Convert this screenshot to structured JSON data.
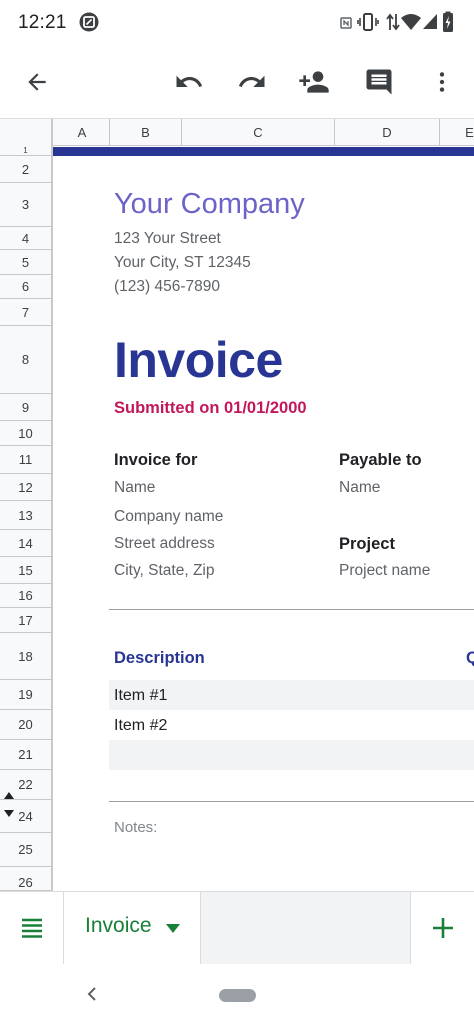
{
  "status_bar": {
    "time": "12:21",
    "icons": [
      "screenshot-icon",
      "nfc-icon",
      "vibrate-icon",
      "data-arrows-icon",
      "wifi-icon",
      "signal-icon",
      "battery-charging-icon"
    ]
  },
  "toolbar": {
    "icons": [
      "back-arrow-icon",
      "undo-icon",
      "redo-icon",
      "add-person-icon",
      "comment-icon",
      "more-vert-icon"
    ]
  },
  "columns": [
    "A",
    "B",
    "C",
    "D",
    "E"
  ],
  "rows": [
    "1",
    "2",
    "3",
    "4",
    "5",
    "6",
    "7",
    "8",
    "9",
    "10",
    "11",
    "12",
    "13",
    "14",
    "15",
    "16",
    "17",
    "18",
    "19",
    "20",
    "21",
    "22",
    "24",
    "25",
    "26"
  ],
  "invoice": {
    "company": "Your Company",
    "street": "123 Your Street",
    "city": "Your City, ST 12345",
    "phone": "(123) 456-7890",
    "title": "Invoice",
    "submitted": "Submitted on 01/01/2000",
    "invoice_for_label": "Invoice for",
    "invoice_for_lines": [
      "Name",
      "Company name",
      "Street address",
      "City, State, Zip"
    ],
    "payable_to_label": "Payable to",
    "payable_to_name": "Name",
    "project_label": "Project",
    "project_name": "Project name",
    "description_label": "Description",
    "next_col_label_partial": "Q",
    "items": [
      "Item #1",
      "Item #2",
      ""
    ],
    "notes_label": "Notes:"
  },
  "tabs": {
    "active_tab": "Invoice"
  },
  "colors": {
    "accent_green": "#188038",
    "banner_blue": "#283593",
    "company_purple": "#6b63c8",
    "submitted_magenta": "#c2185b"
  }
}
